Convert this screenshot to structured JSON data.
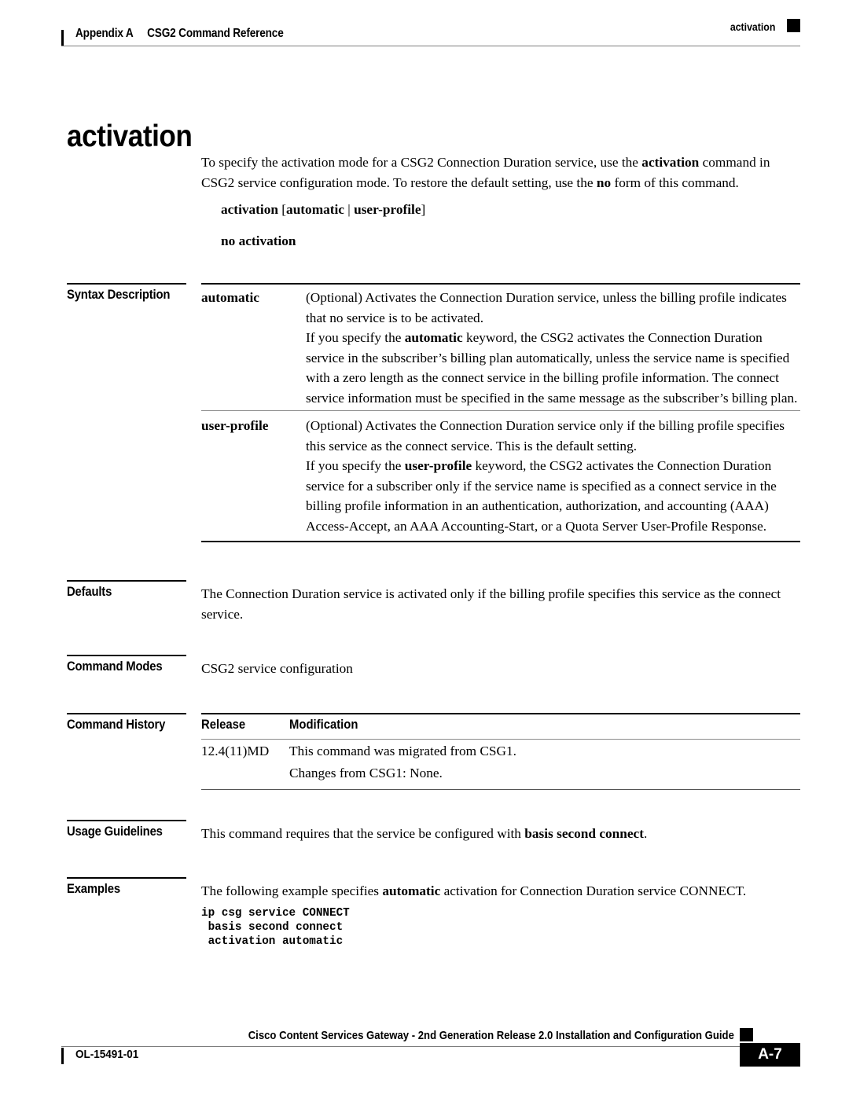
{
  "header": {
    "appendix": "Appendix A",
    "chapter_title": "CSG2 Command Reference",
    "right_marker": "activation"
  },
  "command": {
    "title": "activation",
    "description_line1": "To specify the activation mode for a CSG2 Connection Duration service, use the ",
    "description_bold1": "activation",
    "description_line2": " command in CSG2 service configuration mode. To restore the default setting, use the ",
    "description_bold2": "no",
    "description_line3": " form of this command.",
    "syntax_bold_a": "activation",
    "syntax_bracket_open": " [",
    "syntax_bold_b": "automatic",
    "syntax_pipe": " | ",
    "syntax_bold_c": "user-profile",
    "syntax_bracket_close": "]",
    "no_form": "no activation"
  },
  "sections": {
    "syntax_description": {
      "label": "Syntax Description",
      "rows": [
        {
          "term": "automatic",
          "paragraphs": [
            "(Optional) Activates the Connection Duration service, unless the billing profile indicates that no service is to be activated.",
            "If you specify the automatic keyword, the CSG2 activates the Connection Duration service in the subscriber's billing plan automatically, unless the service name is specified with a zero length as the connect service in the billing profile information. The connect service information must be specified in the same message as the subscriber's billing plan."
          ]
        },
        {
          "term": "user-profile",
          "paragraphs": [
            "(Optional) Activates the Connection Duration service only if the billing profile specifies this service as the connect service. This is the default setting.",
            "If you specify the user-profile keyword, the CSG2 activates the Connection Duration service for a subscriber only if the service name is specified as a connect service in the billing profile information in an authentication, authorization, and accounting (AAA) Access-Accept, an AAA Accounting-Start, or a Quota Server User-Profile Response."
          ]
        }
      ]
    },
    "defaults": {
      "label": "Defaults",
      "text": "The Connection Duration service is activated only if the billing profile specifies this service as the connect service."
    },
    "command_modes": {
      "label": "Command Modes",
      "text": "CSG2 service configuration"
    },
    "command_history": {
      "label": "Command History",
      "columns": [
        "Release",
        "Modification"
      ],
      "rows": [
        {
          "release": "12.4(11)MD",
          "modification": "This command was migrated from CSG1."
        },
        {
          "release": "",
          "modification": "Changes from CSG1: None."
        }
      ]
    },
    "usage_guidelines": {
      "label": "Usage Guidelines",
      "text_before": "This command requires that the service be configured with ",
      "text_bold": "basis second connect",
      "text_after": "."
    },
    "examples": {
      "label": "Examples",
      "intro_before": "The following example specifies ",
      "intro_bold": "automatic",
      "intro_after": " activation for Connection Duration service CONNECT.",
      "code": "ip csg service CONNECT\n basis second connect\n activation automatic"
    }
  },
  "footer": {
    "guide_title": "Cisco Content Services Gateway - 2nd Generation Release 2.0 Installation and Configuration Guide",
    "doc_id": "OL-15491-01",
    "page_number": "A-7"
  }
}
